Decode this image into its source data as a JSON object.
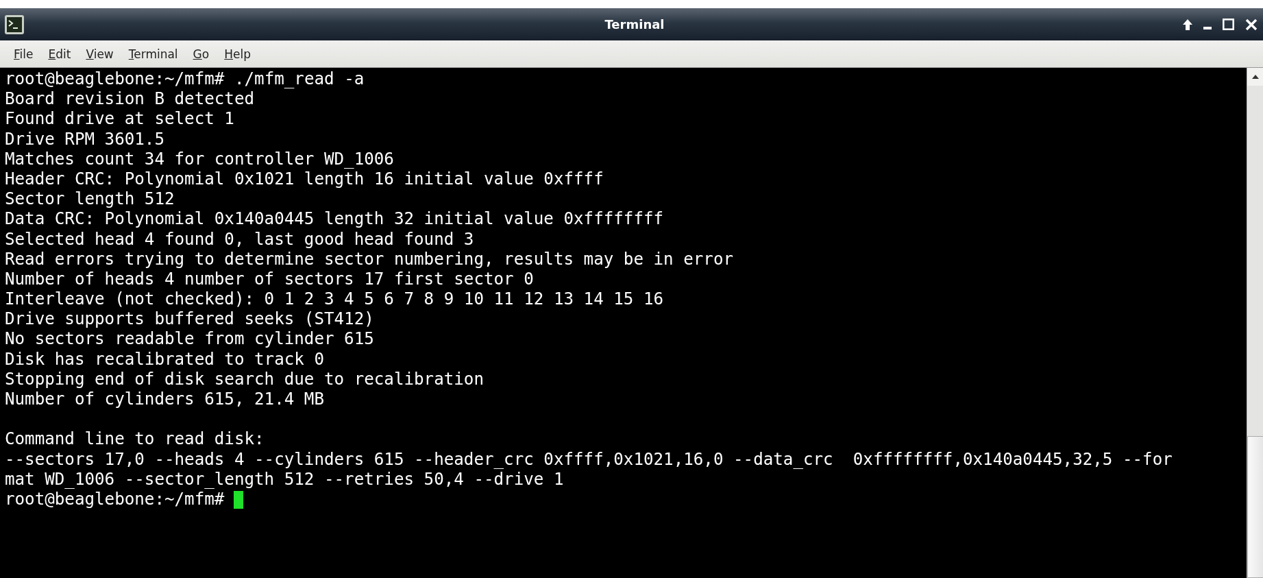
{
  "window": {
    "title": "Terminal"
  },
  "menu": [
    "File",
    "Edit",
    "View",
    "Terminal",
    "Go",
    "Help"
  ],
  "session": [
    {
      "kind": "command",
      "prompt": "root@beaglebone:~/mfm#",
      "command": "./mfm_read -a"
    },
    {
      "kind": "output",
      "text": "Board revision B detected"
    },
    {
      "kind": "output",
      "text": "Found drive at select 1"
    },
    {
      "kind": "output",
      "text": "Drive RPM 3601.5"
    },
    {
      "kind": "output",
      "text": "Matches count 34 for controller WD_1006"
    },
    {
      "kind": "output",
      "text": "Header CRC: Polynomial 0x1021 length 16 initial value 0xffff"
    },
    {
      "kind": "output",
      "text": "Sector length 512"
    },
    {
      "kind": "output",
      "text": "Data CRC: Polynomial 0x140a0445 length 32 initial value 0xffffffff"
    },
    {
      "kind": "output",
      "text": "Selected head 4 found 0, last good head found 3"
    },
    {
      "kind": "output",
      "text": "Read errors trying to determine sector numbering, results may be in error"
    },
    {
      "kind": "output",
      "text": "Number of heads 4 number of sectors 17 first sector 0"
    },
    {
      "kind": "output",
      "text": "Interleave (not checked): 0 1 2 3 4 5 6 7 8 9 10 11 12 13 14 15 16"
    },
    {
      "kind": "output",
      "text": "Drive supports buffered seeks (ST412)"
    },
    {
      "kind": "output",
      "text": "No sectors readable from cylinder 615"
    },
    {
      "kind": "output",
      "text": "Disk has recalibrated to track 0"
    },
    {
      "kind": "output",
      "text": "Stopping end of disk search due to recalibration"
    },
    {
      "kind": "output",
      "text": "Number of cylinders 615, 21.4 MB"
    },
    {
      "kind": "blank"
    },
    {
      "kind": "output",
      "text": "Command line to read disk:"
    },
    {
      "kind": "output",
      "text": "--sectors 17,0 --heads 4 --cylinders 615 --header_crc 0xffff,0x1021,16,0 --data_crc  0xffffffff,0x140a0445,32,5 --for"
    },
    {
      "kind": "output",
      "text": "mat WD_1006 --sector_length 512 --retries 50,4 --drive 1"
    },
    {
      "kind": "prompt",
      "prompt": "root@beaglebone:~/mfm#",
      "cursor": true
    }
  ]
}
